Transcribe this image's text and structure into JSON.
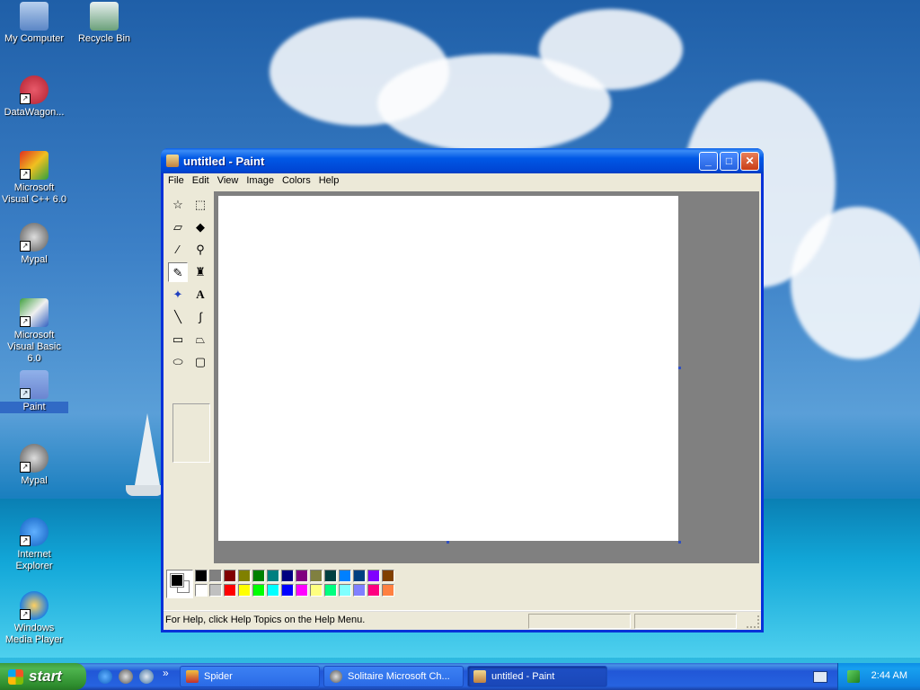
{
  "desktop": {
    "icons": [
      {
        "label": "My Computer"
      },
      {
        "label": "Recycle Bin"
      },
      {
        "label": "DataWagon..."
      },
      {
        "label": "Microsoft Visual C++ 6.0"
      },
      {
        "label": "Mypal"
      },
      {
        "label": "Microsoft Visual Basic 6.0"
      },
      {
        "label": "Paint"
      },
      {
        "label": "Mypal"
      },
      {
        "label": "Internet Explorer"
      },
      {
        "label": "Windows Media Player"
      }
    ]
  },
  "window": {
    "title": "untitled - Paint",
    "controls": {
      "minimize": "_",
      "maximize": "□",
      "close": "✕"
    },
    "menu": [
      "File",
      "Edit",
      "View",
      "Image",
      "Colors",
      "Help"
    ],
    "tools": [
      {
        "icon": "free-form-select-icon",
        "glyph": "☆"
      },
      {
        "icon": "select-icon",
        "glyph": "⬚"
      },
      {
        "icon": "eraser-icon",
        "glyph": "▱"
      },
      {
        "icon": "fill-icon",
        "glyph": "◆"
      },
      {
        "icon": "pick-color-icon",
        "glyph": "⁄"
      },
      {
        "icon": "magnifier-icon",
        "glyph": "⚲"
      },
      {
        "icon": "pencil-icon",
        "glyph": "✎"
      },
      {
        "icon": "brush-icon",
        "glyph": "♜"
      },
      {
        "icon": "airbrush-icon",
        "glyph": "✦"
      },
      {
        "icon": "text-icon",
        "glyph": "A"
      },
      {
        "icon": "line-icon",
        "glyph": "╲"
      },
      {
        "icon": "curve-icon",
        "glyph": "∫"
      },
      {
        "icon": "rectangle-icon",
        "glyph": "▭"
      },
      {
        "icon": "polygon-icon",
        "glyph": "⏢"
      },
      {
        "icon": "ellipse-icon",
        "glyph": "⬭"
      },
      {
        "icon": "rounded-rectangle-icon",
        "glyph": "▢"
      }
    ],
    "active_tool": "pencil-icon",
    "foreground_color": "#000000",
    "background_color": "#ffffff",
    "palette": [
      "#000000",
      "#808080",
      "#800000",
      "#808000",
      "#008000",
      "#008080",
      "#000080",
      "#800080",
      "#808040",
      "#004040",
      "#0080ff",
      "#004080",
      "#8000ff",
      "#804000",
      "#ffffff",
      "#c0c0c0",
      "#ff0000",
      "#ffff00",
      "#00ff00",
      "#00ffff",
      "#0000ff",
      "#ff00ff",
      "#ffff80",
      "#00ff80",
      "#80ffff",
      "#8080ff",
      "#ff0080",
      "#ff8040"
    ],
    "status_text": "For Help, click Help Topics on the Help Menu."
  },
  "taskbar": {
    "start_label": "start",
    "quick_launch": [
      "internet-explorer-icon",
      "mypal-icon",
      "program-icon"
    ],
    "expand_glyph": "»",
    "tasks": [
      {
        "label": "Spider",
        "icon": "spider-icon"
      },
      {
        "label": "Solitaire Microsoft Ch...",
        "icon": "mypal-icon"
      },
      {
        "label": "untitled - Paint",
        "icon": "paint-icon"
      }
    ],
    "clock": "2:44 AM"
  }
}
